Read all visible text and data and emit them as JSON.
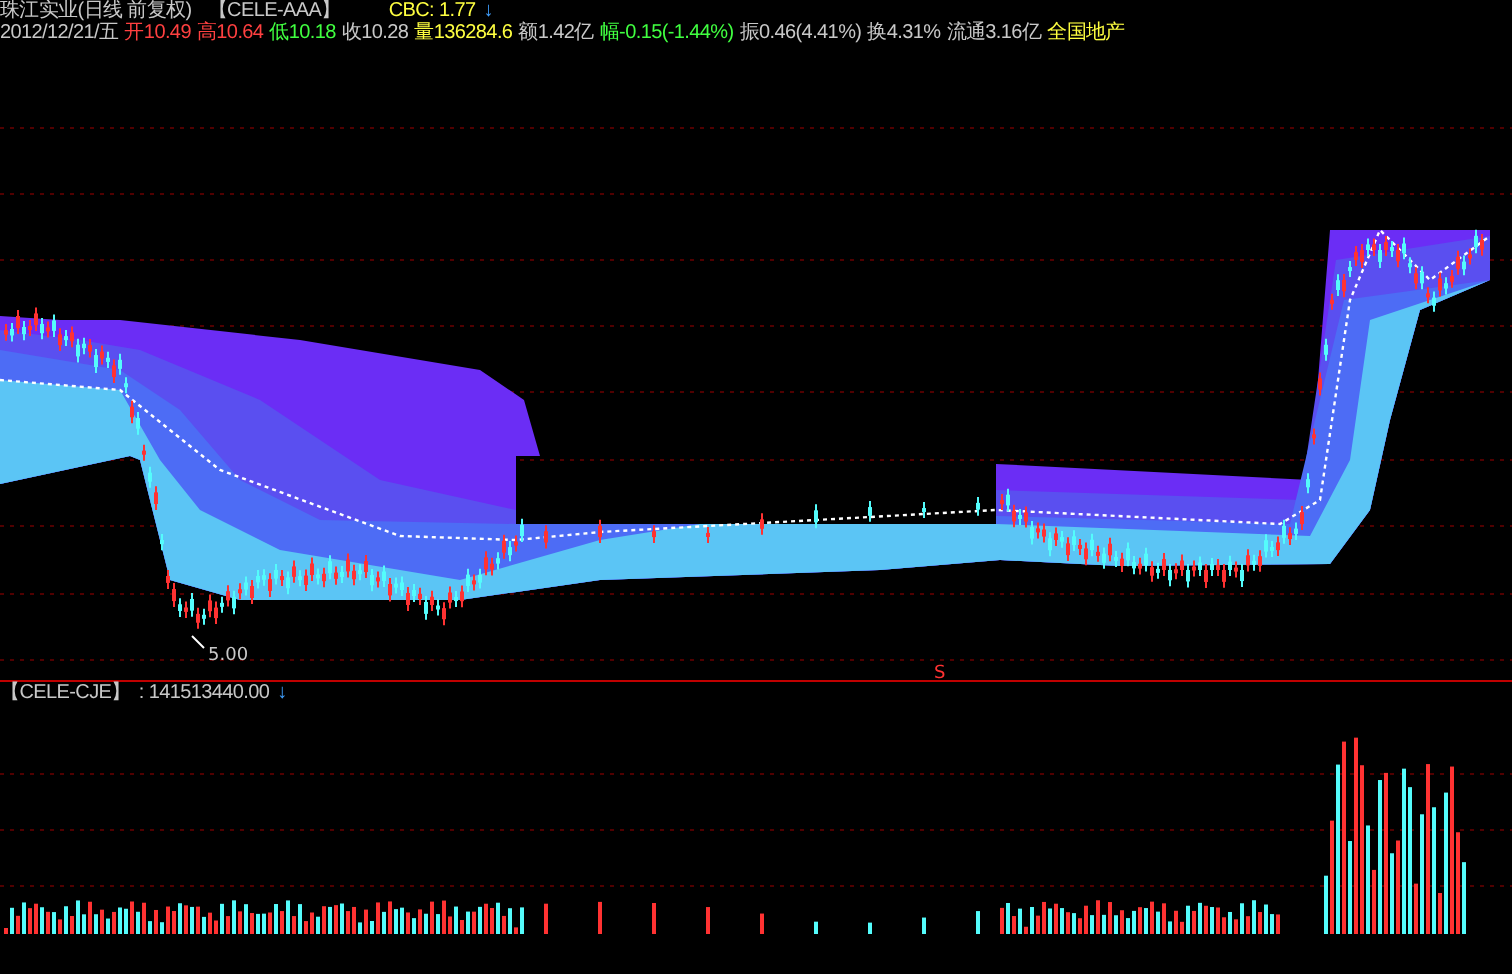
{
  "header": {
    "title": "珠江实业(日线 前复权)",
    "indicator": "【CELE-AAA】",
    "indicator_value": "CBC: 1.77",
    "indicator_arrow": "↓"
  },
  "quote": [
    {
      "text": "2012/12/21/五",
      "color": "#c8c8c8"
    },
    {
      "text": "开10.49",
      "color": "#ff4040"
    },
    {
      "text": "高10.64",
      "color": "#ff4040"
    },
    {
      "text": "低10.18",
      "color": "#40ff40"
    },
    {
      "text": "收10.28",
      "color": "#c8c8c8"
    },
    {
      "text": "量136284.6",
      "color": "#ffff40"
    },
    {
      "text": "额1.42亿",
      "color": "#c8c8c8"
    },
    {
      "text": "幅-0.15(-1.44%)",
      "color": "#40ff40"
    },
    {
      "text": "振0.46(4.41%)",
      "color": "#c8c8c8"
    },
    {
      "text": "换4.31%",
      "color": "#c8c8c8"
    },
    {
      "text": "流通3.16亿",
      "color": "#c8c8c8"
    },
    {
      "text": "全国地产",
      "color": "#ffff40"
    }
  ],
  "main_chart": {
    "low_label": "5.00",
    "signal": "S"
  },
  "sub_panel": {
    "indicator": "【CELE-CJE】",
    "value": ": 141513440.00",
    "arrow": "↓"
  }
}
